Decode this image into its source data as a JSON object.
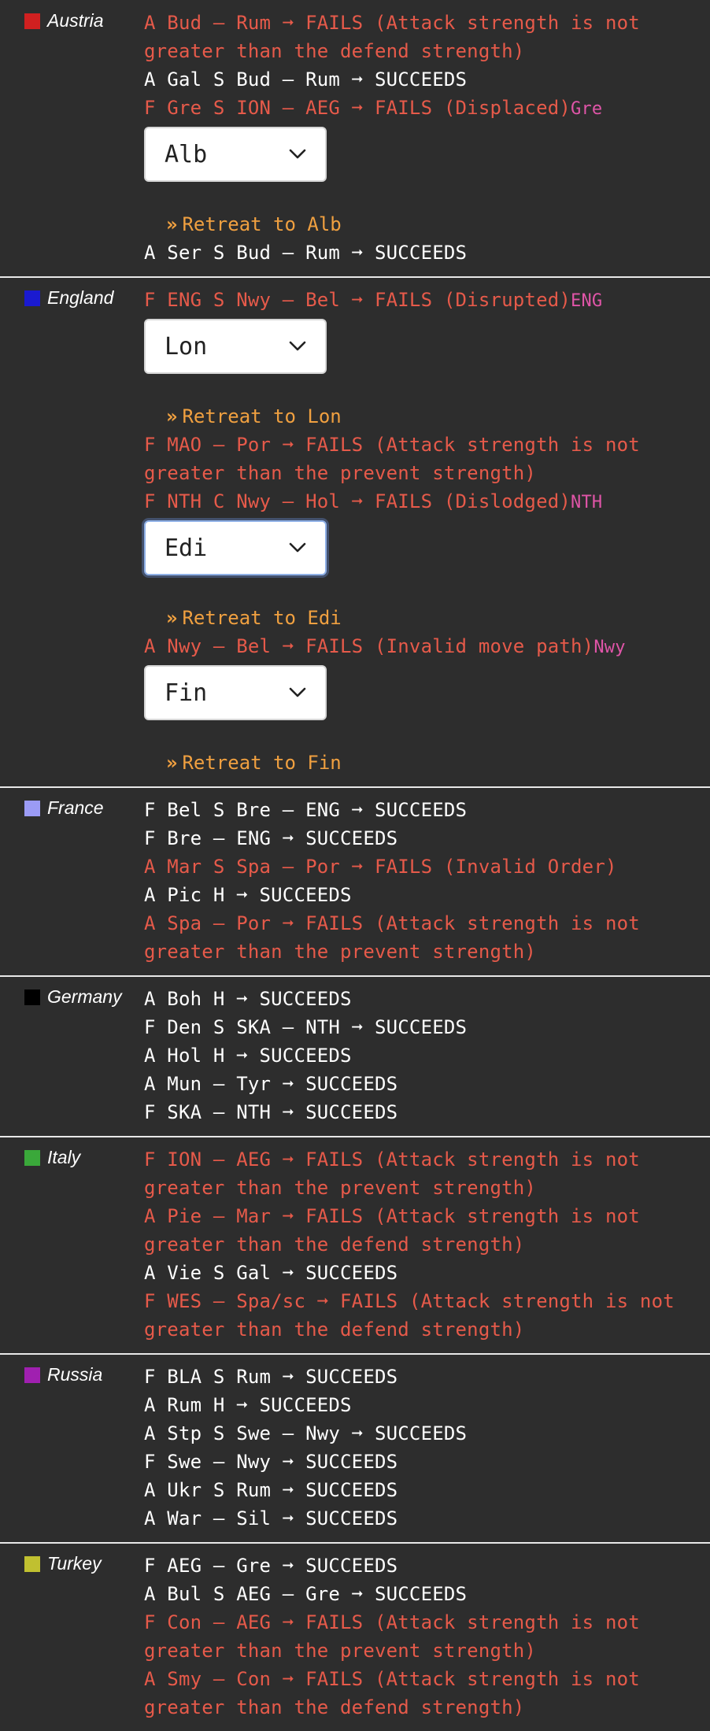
{
  "colors": {
    "background": "#2d2d2d",
    "success": "#ffffff",
    "fail": "#e65a4a",
    "province_tag": "#e055a8",
    "retreat": "#f0a040"
  },
  "retreat_prefix_icon": "double-chevron-right-icon",
  "sections": [
    {
      "nation": "Austria",
      "color": "#d02020",
      "items": [
        {
          "type": "order",
          "text": "A Bud – Rum ➞ FAILS (Attack strength is not greater than the defend strength)",
          "status": "fail"
        },
        {
          "type": "order",
          "text": "A Gal S Bud – Rum ➞ SUCCEEDS",
          "status": "ok"
        },
        {
          "type": "order",
          "text": "F Gre S ION – AEG ➞ FAILS (Displaced)",
          "status": "fail",
          "tag": "Gre",
          "retreat": {
            "selected": "Alb",
            "note": "Retreat to Alb"
          }
        },
        {
          "type": "order",
          "text": "A Ser S Bud – Rum ➞ SUCCEEDS",
          "status": "ok"
        }
      ]
    },
    {
      "nation": "England",
      "color": "#1a1ad0",
      "items": [
        {
          "type": "order",
          "text": "F ENG S Nwy – Bel ➞ FAILS (Disrupted)",
          "status": "fail",
          "tag": "ENG",
          "retreat": {
            "selected": "Lon",
            "note": "Retreat to Lon"
          }
        },
        {
          "type": "order",
          "text": "F MAO – Por ➞ FAILS (Attack strength is not greater than the prevent strength)",
          "status": "fail"
        },
        {
          "type": "order",
          "text": "F NTH C Nwy – Hol ➞ FAILS (Dislodged)",
          "status": "fail",
          "tag": "NTH",
          "retreat": {
            "selected": "Edi",
            "note": "Retreat to Edi",
            "focused": true
          }
        },
        {
          "type": "order",
          "text": "A Nwy – Bel ➞ FAILS (Invalid move path)",
          "status": "fail",
          "tag": "Nwy",
          "retreat": {
            "selected": "Fin",
            "note": "Retreat to Fin"
          }
        }
      ]
    },
    {
      "nation": "France",
      "color": "#9b9bf5",
      "items": [
        {
          "type": "order",
          "text": "F Bel S Bre – ENG ➞ SUCCEEDS",
          "status": "ok"
        },
        {
          "type": "order",
          "text": "F Bre – ENG ➞ SUCCEEDS",
          "status": "ok"
        },
        {
          "type": "order",
          "text": "A Mar S Spa – Por ➞ FAILS (Invalid Order)",
          "status": "fail"
        },
        {
          "type": "order",
          "text": "A Pic H ➞ SUCCEEDS",
          "status": "ok"
        },
        {
          "type": "order",
          "text": "A Spa – Por ➞ FAILS (Attack strength is not greater than the prevent strength)",
          "status": "fail"
        }
      ]
    },
    {
      "nation": "Germany",
      "color": "#000000",
      "items": [
        {
          "type": "order",
          "text": "A Boh H ➞ SUCCEEDS",
          "status": "ok"
        },
        {
          "type": "order",
          "text": "F Den S SKA – NTH ➞ SUCCEEDS",
          "status": "ok"
        },
        {
          "type": "order",
          "text": "A Hol H ➞ SUCCEEDS",
          "status": "ok"
        },
        {
          "type": "order",
          "text": "A Mun – Tyr ➞ SUCCEEDS",
          "status": "ok"
        },
        {
          "type": "order",
          "text": "F SKA – NTH ➞ SUCCEEDS",
          "status": "ok"
        }
      ]
    },
    {
      "nation": "Italy",
      "color": "#3aa83a",
      "items": [
        {
          "type": "order",
          "text": "F ION – AEG ➞ FAILS (Attack strength is not greater than the prevent strength)",
          "status": "fail"
        },
        {
          "type": "order",
          "text": "A Pie – Mar ➞ FAILS (Attack strength is not greater than the defend strength)",
          "status": "fail"
        },
        {
          "type": "order",
          "text": "A Vie S Gal ➞ SUCCEEDS",
          "status": "ok"
        },
        {
          "type": "order",
          "text": "F WES – Spa/sc ➞ FAILS (Attack strength is not greater than the defend strength)",
          "status": "fail"
        }
      ]
    },
    {
      "nation": "Russia",
      "color": "#a020b0",
      "items": [
        {
          "type": "order",
          "text": "F BLA S Rum ➞ SUCCEEDS",
          "status": "ok"
        },
        {
          "type": "order",
          "text": "A Rum H ➞ SUCCEEDS",
          "status": "ok"
        },
        {
          "type": "order",
          "text": "A Stp S Swe – Nwy ➞ SUCCEEDS",
          "status": "ok"
        },
        {
          "type": "order",
          "text": "F Swe – Nwy ➞ SUCCEEDS",
          "status": "ok"
        },
        {
          "type": "order",
          "text": "A Ukr S Rum ➞ SUCCEEDS",
          "status": "ok"
        },
        {
          "type": "order",
          "text": "A War – Sil ➞ SUCCEEDS",
          "status": "ok"
        }
      ]
    },
    {
      "nation": "Turkey",
      "color": "#c0c030",
      "items": [
        {
          "type": "order",
          "text": "F AEG – Gre ➞ SUCCEEDS",
          "status": "ok"
        },
        {
          "type": "order",
          "text": "A Bul S AEG – Gre ➞ SUCCEEDS",
          "status": "ok"
        },
        {
          "type": "order",
          "text": "F Con – AEG ➞ FAILS (Attack strength is not greater than the prevent strength)",
          "status": "fail"
        },
        {
          "type": "order",
          "text": "A Smy – Con ➞ FAILS (Attack strength is not greater than the defend strength)",
          "status": "fail"
        }
      ]
    }
  ]
}
